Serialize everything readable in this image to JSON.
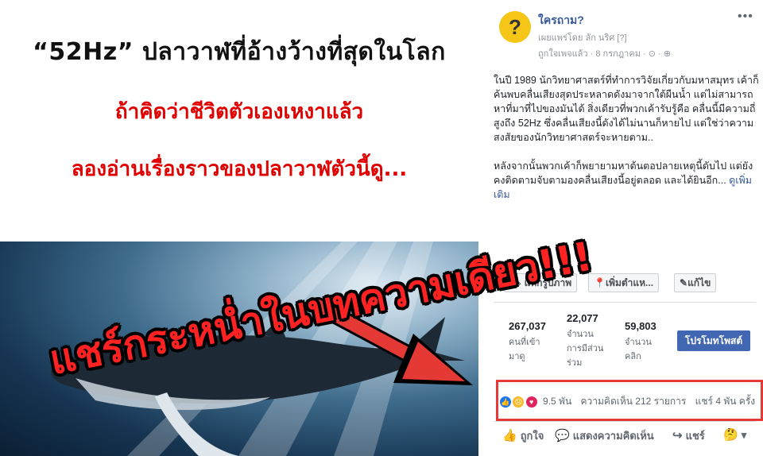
{
  "image": {
    "headline_1": "“52Hz” ปลาวาฬที่อ้างว้างที่สุดในโลก",
    "headline_2": "ถ้าคิดว่าชีวิตตัวเองเหงาแล้ว",
    "headline_3": "ลองอ่านเรื่องราวของปลาวาฬตัวนี้ดู...",
    "overlay_text": "แชร์กระหน่ำในบทความเดียว!!!",
    "colors": {
      "headline_red": "#e00000",
      "overlay_red": "#ff2222",
      "arrow_red": "#e53935"
    }
  },
  "post": {
    "page_name": "ใครถาม?",
    "avatar_icon": "question-face-icon",
    "avatar_glyph": "?",
    "more_label": "•••",
    "meta_published": "เผยแพร่โดย ลัก นริศ [?]",
    "meta_date": "ถูกใจเพจแล้ว · 8 กรกฎาคม · ⊙ · ⊕",
    "text_p1": "ในปี 1989 นักวิทยาศาสตร์ที่ทำการวิจัยเกี่ยวกับมหาสมุทร เค้าก็ค้นพบคลื่นเสียงสุดประหลาดดังมาจากใต้ผืนน้ำ แต่ไม่สามารถหาที่มาที่ไปของมันได้ สิ่งเดียวที่พวกเค้ารับรู้คือ คลื่นนี้มีความถี่สูงถึง 52Hz ซึ่งคลื่นเสียงนี้ดังได้ไม่นานก็หายไป แต่ใช่ว่าความสงสัยของนักวิทยาศาสตร์จะหายตาม..",
    "text_p2": "หลังจากนั้นพวกเค้าก็พยายามหาต้นตอปลายเหตุนี้ดับไป แต่ยังคงติดตามจับตามองคลื่นเสียงนี้อยู่ตลอด และได้ยินอีก...",
    "see_more": "ดูเพิ่มเติม"
  },
  "tools": {
    "tag_photo": "แท็กรูปภาพ",
    "add_location": "เพิ่มตำแห...",
    "edit": "แก้ไข"
  },
  "stats": {
    "reach_num": "267,037",
    "reach_label_1": "คนที่เข้า",
    "reach_label_2": "มาดู",
    "engage_num": "22,077",
    "engage_label_1": "จำนวน",
    "engage_label_2": "การมีส่วน",
    "engage_label_3": "ร่วม",
    "clicks_num": "59,803",
    "clicks_label_1": "จำนวน",
    "clicks_label_2": "คลิก",
    "promote_label": "โปรโมทโพสต์"
  },
  "reactions": {
    "icons": [
      "like-icon",
      "sad-icon",
      "love-icon"
    ],
    "count": "9.5 พัน",
    "comments": "ความคิดเห็น 212 รายการ",
    "shares": "แชร์ 4 พัน ครั้ง"
  },
  "actions": {
    "like": "ถูกใจ",
    "comment": "แสดงความคิดเห็น",
    "share": "แชร์"
  }
}
